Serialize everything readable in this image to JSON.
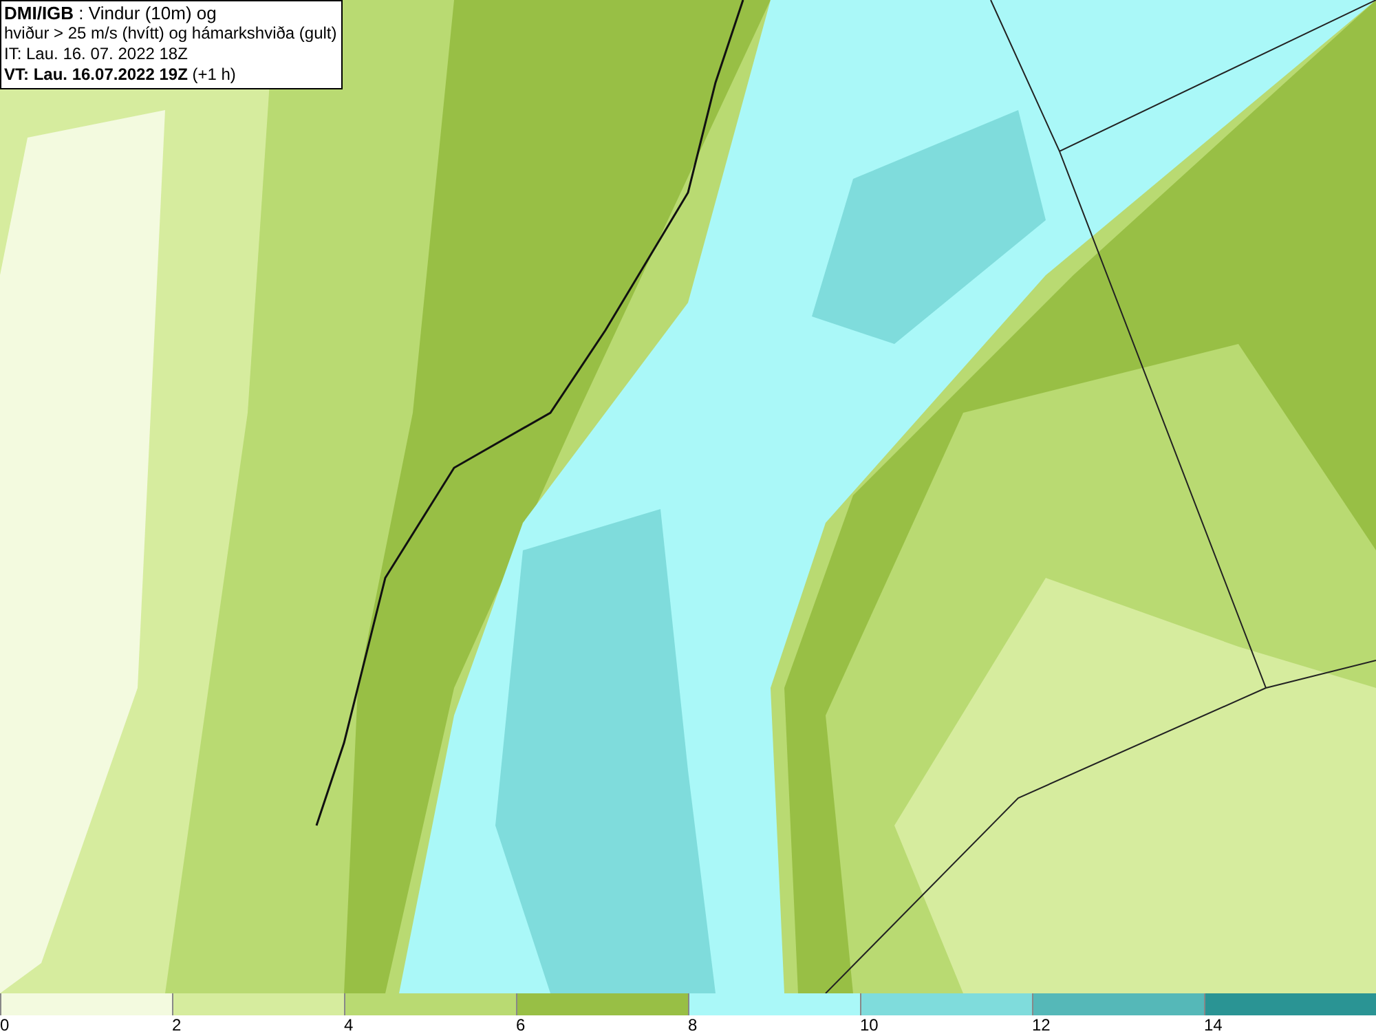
{
  "header": {
    "lines": [
      "**DMI/IGB** : Vindur (10m) og",
      "hviður > 25 m/s (hvítt) og hámarkshviða (gult)",
      "IT: Lau. 16. 07. 2022 18Z",
      "**VT: Lau. 16.07.2022 19Z** (+1 h)"
    ]
  },
  "legend": {
    "segments": [
      {
        "color": "#f3fadf"
      },
      {
        "color": "#d6ec9e"
      },
      {
        "color": "#b9da72"
      },
      {
        "color": "#98bf45"
      },
      {
        "color": "#aaf8f8"
      },
      {
        "color": "#7fdcdc"
      },
      {
        "color": "#55b8b8"
      },
      {
        "color": "#2a9494"
      }
    ],
    "ticks": [
      "0",
      "2",
      "4",
      "6",
      "8",
      "10",
      "12",
      "14"
    ]
  }
}
